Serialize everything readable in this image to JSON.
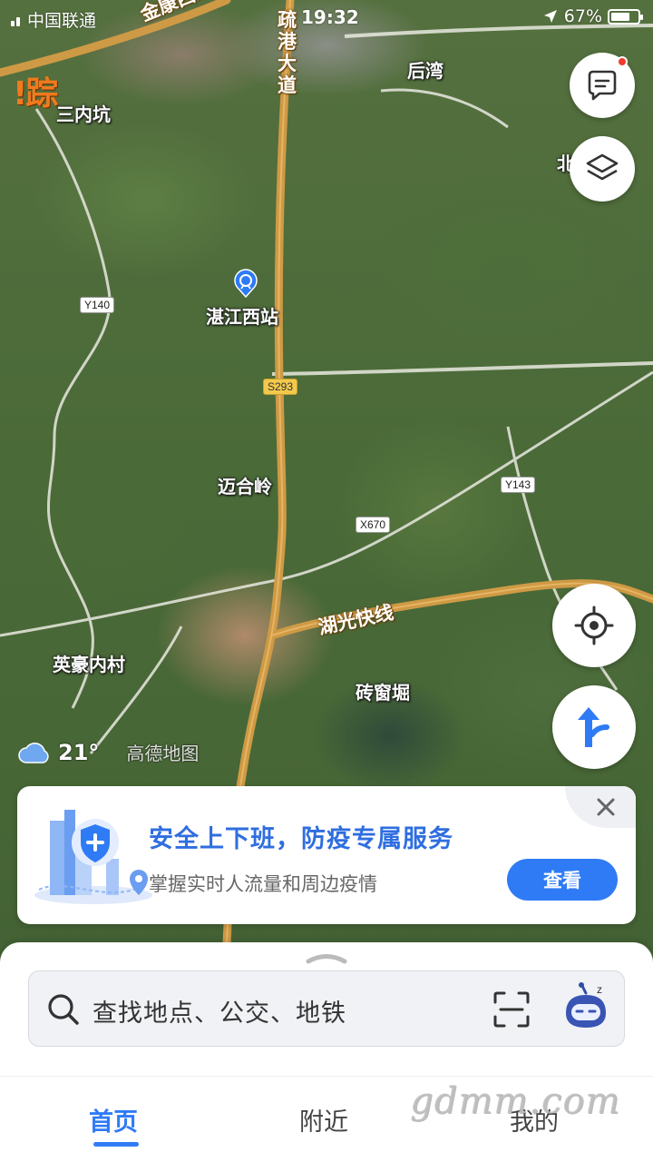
{
  "status_bar": {
    "carrier": "中国联通",
    "time": "19:32",
    "battery": "67%"
  },
  "map": {
    "watermark": "!踪",
    "places": {
      "sannei": "三内坑",
      "houwan": "后湾",
      "bei": "北",
      "station": "湛江西站",
      "maihe": "迈合岭",
      "yinghao": "英豪内村",
      "zhuanyao": "砖窗堀"
    },
    "roads": {
      "jinkang": "金康西路",
      "shugang": "疏港大道",
      "huguang": "湖光快线"
    },
    "shields": {
      "y140": "Y140",
      "s293": "S293",
      "y143": "Y143",
      "x670": "X670"
    }
  },
  "weather": {
    "temperature": "21°",
    "logo": "高德地图"
  },
  "banner": {
    "title": "安全上下班，防疫专属服务",
    "subtitle": "掌握实时人流量和周边疫情",
    "button": "查看"
  },
  "search": {
    "placeholder": "查找地点、公交、地铁"
  },
  "tabs": {
    "home": "首页",
    "nearby": "附近",
    "mine": "我的"
  },
  "site_watermark": "gdmm.com",
  "colors": {
    "accent": "#2f7bf5",
    "title_blue": "#2f6ee0",
    "road": "#d9a24a",
    "notify_dot": "#f23a2e"
  },
  "icons": [
    "message-icon",
    "layers-icon",
    "locate-icon",
    "route-icon",
    "close-icon",
    "search-icon",
    "scan-icon",
    "assistant-bot-icon",
    "weather-cloud-icon",
    "station-icon"
  ]
}
